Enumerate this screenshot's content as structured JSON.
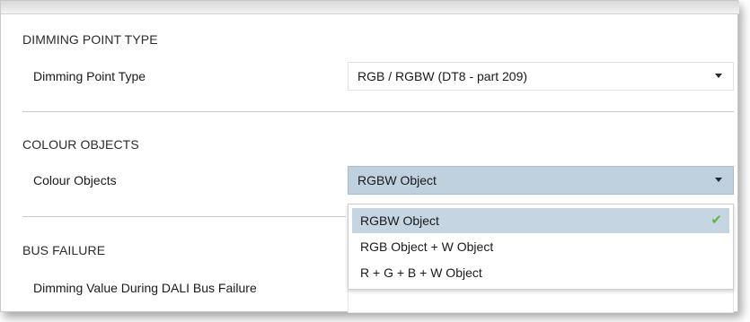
{
  "sections": {
    "dimming_point_type": {
      "title": "DIMMING POINT TYPE",
      "param_label": "Dimming Point Type",
      "value": "RGB / RGBW (DT8 - part 209)"
    },
    "colour_objects": {
      "title": "COLOUR OBJECTS",
      "param_label": "Colour Objects",
      "value": "RGBW Object",
      "options": [
        {
          "label": "RGBW Object",
          "selected": true
        },
        {
          "label": "RGB Object + W Object",
          "selected": false
        },
        {
          "label": "R + G + B + W Object",
          "selected": false
        }
      ]
    },
    "bus_failure": {
      "title": "BUS FAILURE",
      "param_label": "Dimming Value During DALI Bus Failure"
    }
  },
  "icons": {
    "dropdown": "chevron-down-icon",
    "selected_check": "checkmark-icon"
  },
  "colors": {
    "active_select_bg": "#bfd0df",
    "selected_option_bg": "#c6d5e2",
    "check_green": "#63b33c"
  }
}
